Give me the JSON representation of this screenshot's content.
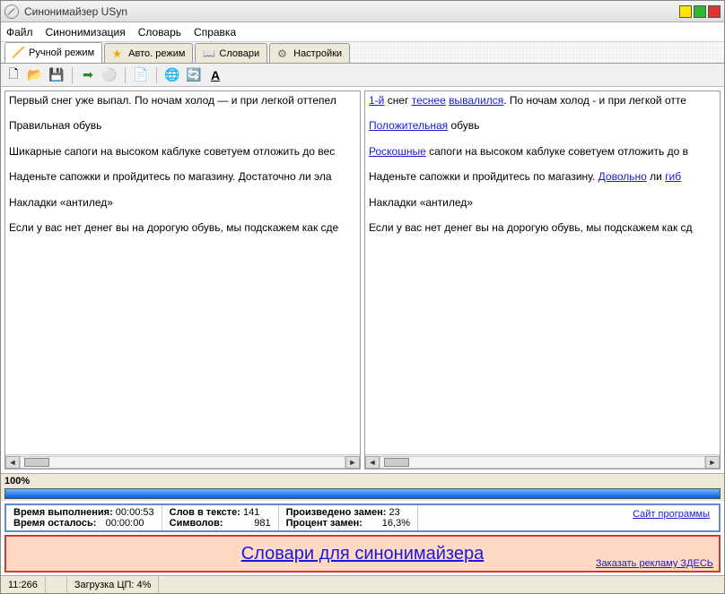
{
  "title": "Синонимайзер USyn",
  "menu": {
    "file": "Файл",
    "syn": "Синонимизация",
    "dict": "Словарь",
    "help": "Справка"
  },
  "tabs": {
    "manual": "Ручной режим",
    "auto": "Авто. режим",
    "dicts": "Словари",
    "settings": "Настройки"
  },
  "left": {
    "p1": "Первый снег уже выпал. По ночам холод — и при легкой оттепел",
    "p2": "Правильная обувь",
    "p3": "Шикарные сапоги на высоком каблуке советуем отложить до вес",
    "p4": "Наденьте сапожки и пройдитесь по магазину. Достаточно ли эла",
    "p5": "Накладки «антилед»",
    "p6": "Если у вас нет денег вы на дорогую обувь, мы подскажем как сде"
  },
  "right": {
    "p1a": "1-й",
    "p1b": " снег ",
    "p1c": "теснее",
    "p1d": " ",
    "p1e": "вывалился",
    "p1f": ". По ночам холод - и при легкой отте",
    "p2a": "Положительная",
    "p2b": " обувь",
    "p3a": "Роскошные",
    "p3b": " сапоги на высоком каблуке советуем отложить до в",
    "p4a": "Наденьте сапожки и пройдитесь по магазину. ",
    "p4b": "Довольно",
    "p4c": " ли ",
    "p4d": "гиб",
    "p5": "Накладки «антилед»",
    "p6": "Если у вас нет денег вы на дорогую обувь, мы подскажем как сд"
  },
  "progress": {
    "percent": "100%"
  },
  "stats": {
    "l1": "Время выполнения:",
    "v1": "00:00:53",
    "l2": "Время осталось:",
    "v2": "00:00:00",
    "l3": "Слов в тексте:",
    "v3": "141",
    "l4": "Символов:",
    "v4": "981",
    "l5": "Произведено замен:",
    "v5": "23",
    "l6": "Процент замен:",
    "v6": "16,3%",
    "site": "Сайт программы"
  },
  "ad": {
    "big": "Словари для синонимайзера",
    "small": "Заказать рекламу ЗДЕСЬ"
  },
  "status": {
    "pos": "11:266",
    "cpu": "Загрузка ЦП: 4%"
  },
  "icons": {
    "new": "🗋",
    "open": "📂",
    "save": "💾",
    "run": "➡",
    "stop": "⚪",
    "export": "📄",
    "globe": "🌐",
    "refresh": "🔄",
    "font": "A"
  }
}
